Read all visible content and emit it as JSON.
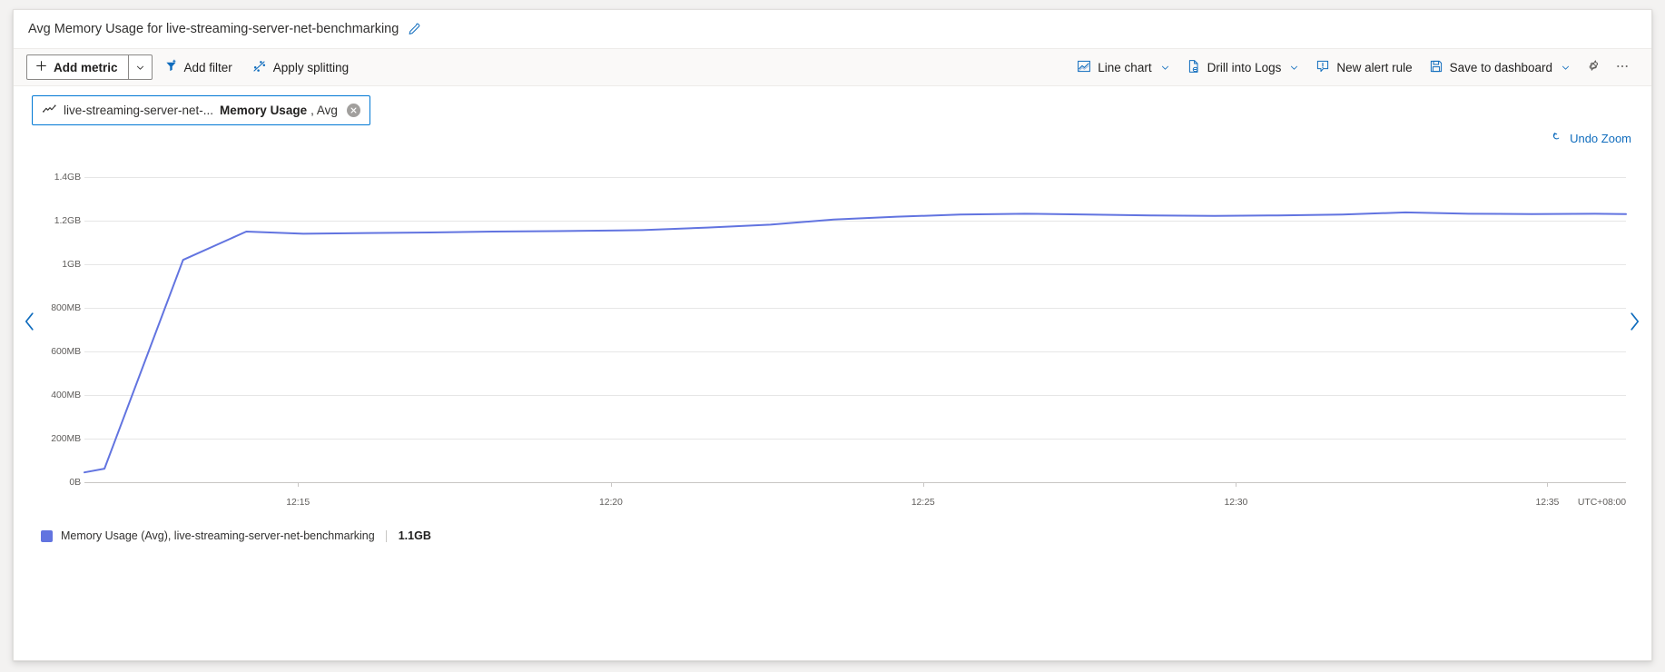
{
  "header": {
    "title": "Avg Memory Usage for live-streaming-server-net-benchmarking",
    "edit_icon": "pencil-icon"
  },
  "toolbar": {
    "add_metric_label": "Add metric",
    "add_metric_caret": "chevron-down-icon",
    "add_filter_label": "Add filter",
    "apply_splitting_label": "Apply splitting",
    "line_chart_label": "Line chart",
    "drill_into_logs_label": "Drill into Logs",
    "new_alert_rule_label": "New alert rule",
    "save_to_dashboard_label": "Save to dashboard",
    "settings_icon": "gear-icon",
    "more_icon": "ellipsis-icon"
  },
  "metric_chip": {
    "icon": "metric-line-icon",
    "resource": "live-streaming-server-net-...",
    "metric": "Memory Usage",
    "aggregation": ", Avg",
    "close_icon": "close-circle-icon"
  },
  "undo_zoom": {
    "label": "Undo Zoom",
    "icon": "undo-arrow-icon"
  },
  "nav": {
    "prev_icon": "chevron-left-icon",
    "next_icon": "chevron-right-icon"
  },
  "legend": {
    "swatch_color": "#6274e0",
    "label": "Memory Usage (Avg), live-streaming-server-net-benchmarking",
    "value": "1.1GB"
  },
  "chart_data": {
    "type": "line",
    "title": "Avg Memory Usage for live-streaming-server-net-benchmarking",
    "xlabel": "",
    "ylabel": "",
    "timezone": "UTC+08:00",
    "grid": true,
    "legend_position": "bottom-left",
    "line_color": "#6274e0",
    "ytick_labels": [
      "1.4GB",
      "1.2GB",
      "1GB",
      "800MB",
      "600MB",
      "400MB",
      "200MB",
      "0B"
    ],
    "ytick_values": [
      1400,
      1200,
      1000,
      800,
      600,
      400,
      200,
      0
    ],
    "ylim": [
      0,
      1450
    ],
    "yunit": "MB",
    "xtick_labels": [
      "12:15",
      "12:20",
      "12:25",
      "12:30",
      "12:35"
    ],
    "xtick_positions": [
      0.1385,
      0.3415,
      0.544,
      0.747,
      0.949
    ],
    "xlim_labels": [
      "12:13",
      "12:37"
    ],
    "series": [
      {
        "name": "Memory Usage (Avg), live-streaming-server-net-benchmarking",
        "x": [
          0.0,
          0.013,
          0.064,
          0.105,
          0.142,
          0.183,
          0.224,
          0.265,
          0.306,
          0.347,
          0.362,
          0.404,
          0.445,
          0.486,
          0.527,
          0.568,
          0.61,
          0.651,
          0.692,
          0.733,
          0.774,
          0.816,
          0.857,
          0.898,
          0.939,
          0.98,
          1.0
        ],
        "values": [
          45,
          62,
          1020,
          1150,
          1140,
          1143,
          1146,
          1150,
          1152,
          1155,
          1157,
          1168,
          1182,
          1205,
          1218,
          1228,
          1232,
          1228,
          1224,
          1222,
          1224,
          1228,
          1238,
          1232,
          1230,
          1232,
          1230
        ]
      }
    ]
  }
}
